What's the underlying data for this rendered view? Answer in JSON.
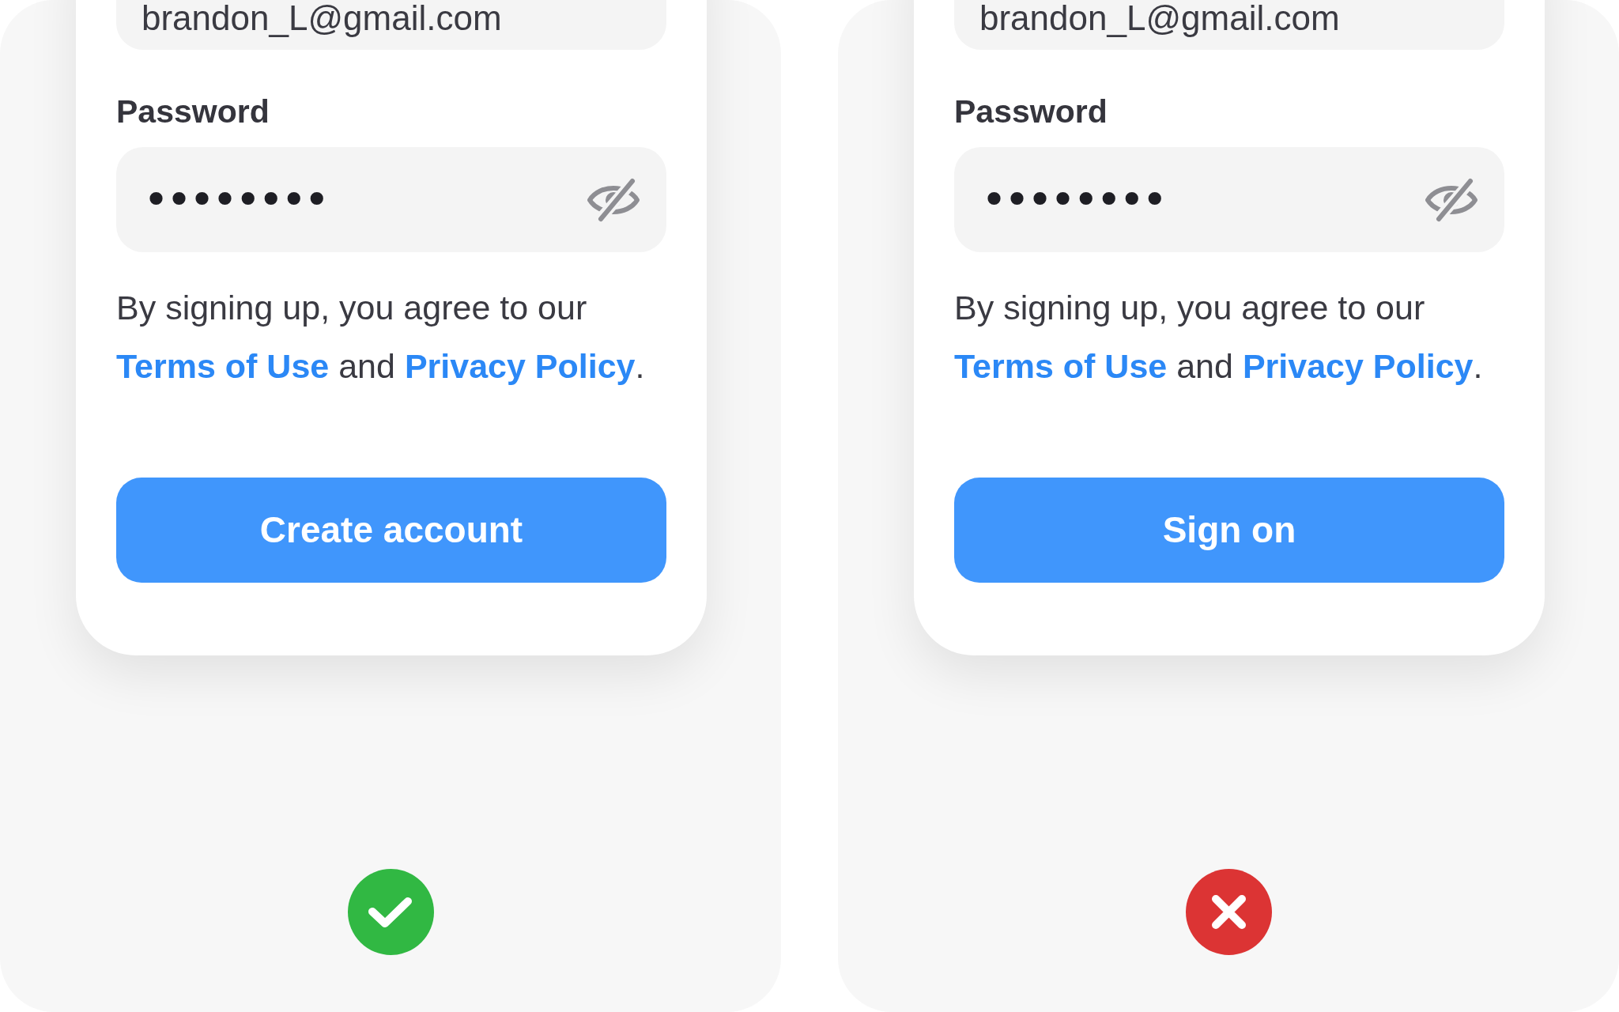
{
  "examples": [
    {
      "kind": "correct",
      "email_field": {
        "value": "brandon_L@gmail.com"
      },
      "password_label": "Password",
      "password_field": {
        "value": "••••••••"
      },
      "agreement": [
        {
          "kind": "text",
          "text": "By signing up, you agree to our "
        },
        {
          "kind": "link",
          "text": "Terms of Use"
        },
        {
          "kind": "text",
          "text": " and "
        },
        {
          "kind": "link",
          "text": "Privacy Policy"
        },
        {
          "kind": "text",
          "text": "."
        }
      ],
      "submit_button": "Create account"
    },
    {
      "kind": "wrong",
      "email_field": {
        "value": "brandon_L@gmail.com"
      },
      "password_label": "Password",
      "password_field": {
        "value": "••••••••"
      },
      "agreement": [
        {
          "kind": "text",
          "text": "By signing up, you agree to our "
        },
        {
          "kind": "link",
          "text": "Terms of Use"
        },
        {
          "kind": "text",
          "text": " and "
        },
        {
          "kind": "link",
          "text": "Privacy Policy"
        },
        {
          "kind": "text",
          "text": "."
        }
      ],
      "submit_button": "Sign on"
    }
  ]
}
